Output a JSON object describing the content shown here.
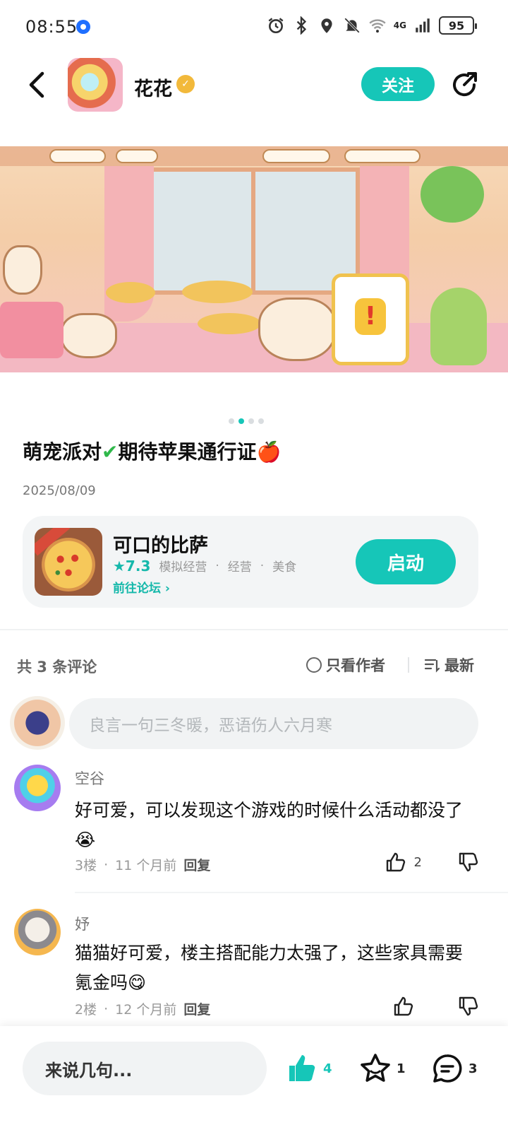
{
  "status_bar": {
    "time": "08:55",
    "battery": "95",
    "network": "4G"
  },
  "header": {
    "author": "花花",
    "follow_label": "关注"
  },
  "post": {
    "title": "萌宠派对",
    "title_mid": "期待苹果通行证",
    "date": "2025/08/09",
    "carousel_total": 4,
    "carousel_active": 2
  },
  "game": {
    "name": "可口的比萨",
    "rating": "★7.3",
    "tags": [
      "模拟经营",
      "经营",
      "美食"
    ],
    "forum_link": "前往论坛 ›",
    "launch_label": "启动"
  },
  "comments_header": {
    "count_label": "共 3 条评论",
    "only_author": "只看作者",
    "sort": "最新"
  },
  "comment_input": {
    "placeholder": "良言一句三冬暖，恶语伤人六月寒"
  },
  "comments": [
    {
      "name": "空谷",
      "body": "好可爱，可以发现这个游戏的时候什么活动都没了😭",
      "floor": "3楼",
      "time": "11 个月前",
      "reply": "回复",
      "likes": "2"
    },
    {
      "name": "妤",
      "body": "猫猫好可爱，楼主搭配能力太强了，这些家具需要氪金吗😋",
      "floor": "2楼",
      "time": "12 个月前",
      "reply": "回复",
      "likes": ""
    }
  ],
  "bottom_bar": {
    "placeholder": "来说几句...",
    "likes": "4",
    "favorites": "1",
    "comments": "3"
  },
  "colors": {
    "accent": "#16c6b8"
  },
  "icons": [
    "back-icon",
    "verified-icon",
    "share-icon",
    "star-icon",
    "chevron-right-icon",
    "radio-icon",
    "sort-icon",
    "thumb-up-icon",
    "thumb-down-icon",
    "comment-icon"
  ]
}
